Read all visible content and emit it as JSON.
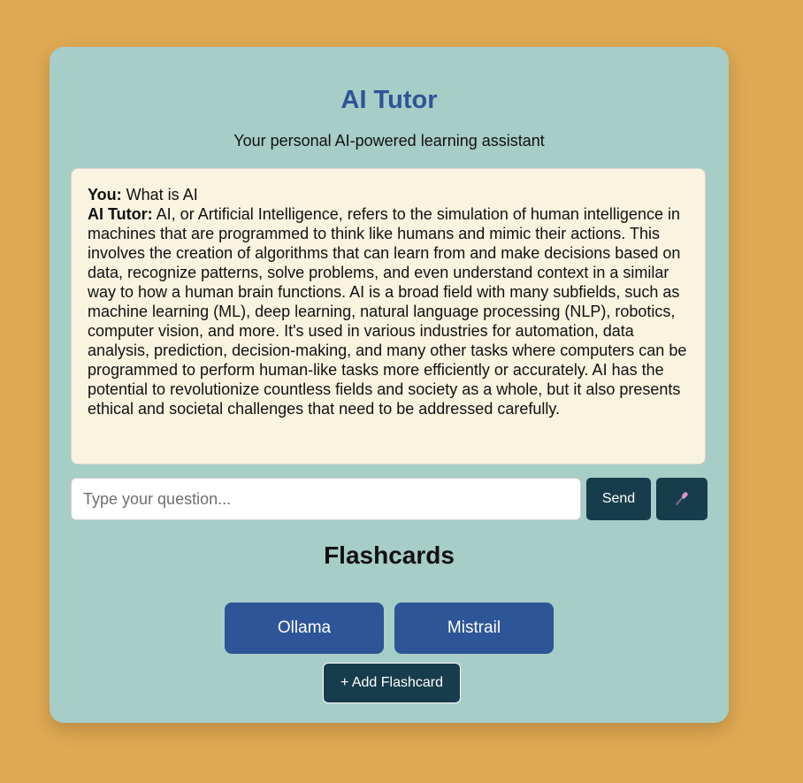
{
  "header": {
    "title": "AI Tutor",
    "subtitle": "Your personal AI-powered learning assistant"
  },
  "chat": {
    "messages": [
      {
        "speaker": "You:",
        "text": "What is AI"
      },
      {
        "speaker": "AI Tutor:",
        "text": "AI, or Artificial Intelligence, refers to the simulation of human intelligence in machines that are programmed to think like humans and mimic their actions. This involves the creation of algorithms that can learn from and make decisions based on data, recognize patterns, solve problems, and even understand context in a similar way to how a human brain functions. AI is a broad field with many subfields, such as machine learning (ML), deep learning, natural language processing (NLP), robotics, computer vision, and more. It's used in various industries for automation, data analysis, prediction, decision-making, and many other tasks where computers can be programmed to perform human-like tasks more efficiently or accurately. AI has the potential to revolutionize countless fields and society as a whole, but it also presents ethical and societal challenges that need to be addressed carefully."
      }
    ]
  },
  "input": {
    "placeholder": "Type your question...",
    "value": "",
    "send_label": "Send",
    "mic_icon": "microphone-icon"
  },
  "flashcards": {
    "title": "Flashcards",
    "cards": [
      {
        "label": "Ollama"
      },
      {
        "label": "Mistrail"
      }
    ],
    "add_label": "+ Add Flashcard"
  },
  "colors": {
    "page_background": "#dfa953",
    "card_background": "#a7cdc7",
    "title_color": "#2e5597",
    "chat_background": "#f9f3df",
    "button_dark": "#173d4c",
    "flashcard_blue": "#2d5598"
  }
}
